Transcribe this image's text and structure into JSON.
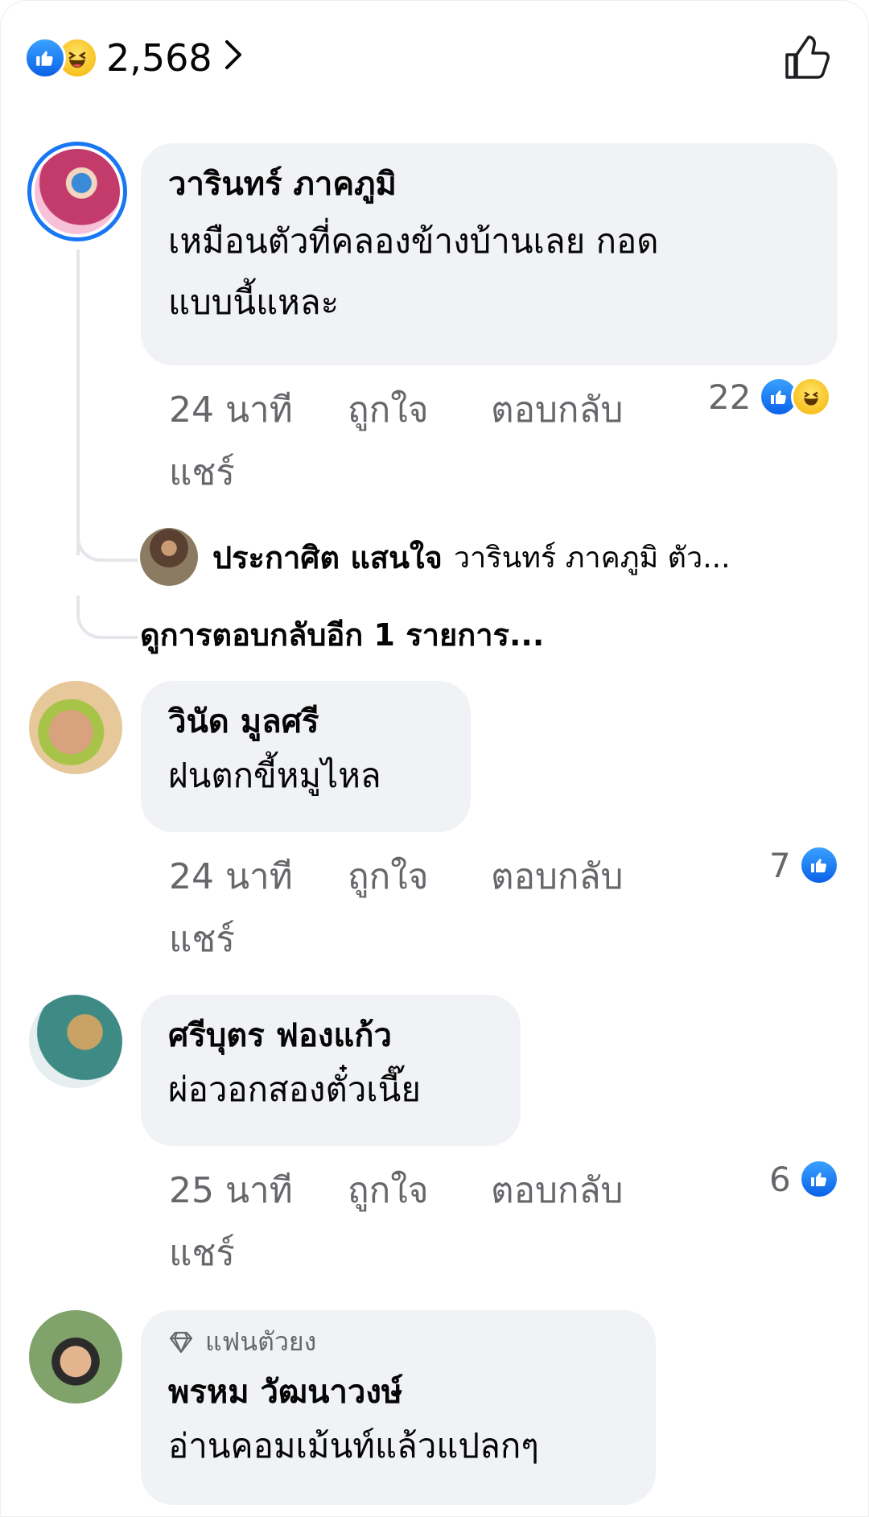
{
  "summary": {
    "count": "2,568"
  },
  "comments": [
    {
      "name": "วารินทร์ ภาคภูมิ",
      "text_line1": "เหมือนตัวที่คลองข้างบ้านเลย กอด",
      "text_line2": "แบบนี้แหละ",
      "time": "24 นาที",
      "like": "ถูกใจ",
      "reply": "ตอบกลับ",
      "share": "แชร์",
      "reaction_count": "22",
      "reply_preview": {
        "name": "ประกาศิต แสนใจ",
        "text": "วารินทร์ ภาคภูมิ ตัว..."
      },
      "more_replies": "ดูการตอบกลับอีก 1 รายการ..."
    },
    {
      "name": "วินัด มูลศรี",
      "text_line1": "ฝนตกขี้หมูไหล",
      "time": "24 นาที",
      "like": "ถูกใจ",
      "reply": "ตอบกลับ",
      "share": "แชร์",
      "reaction_count": "7"
    },
    {
      "name": "ศรีบุตร ฟองแก้ว",
      "text_line1": "ผ่อวอกสองตั๋วเนี๊ย",
      "time": "25 นาที",
      "like": "ถูกใจ",
      "reply": "ตอบกลับ",
      "share": "แชร์",
      "reaction_count": "6"
    },
    {
      "badge": "แฟนตัวยง",
      "name": "พรหม วัฒนาวงษ์",
      "text_line1": "อ่านคอมเม้นท์แล้วแปลกๆ"
    }
  ],
  "colors": {
    "accent": "#1877f2",
    "bubble": "#f0f2f5",
    "meta": "#65676b"
  },
  "icons": [
    "like-reaction-icon",
    "haha-reaction-icon",
    "chevron-right-icon",
    "thumbs-up-outline-icon",
    "diamond-icon"
  ]
}
